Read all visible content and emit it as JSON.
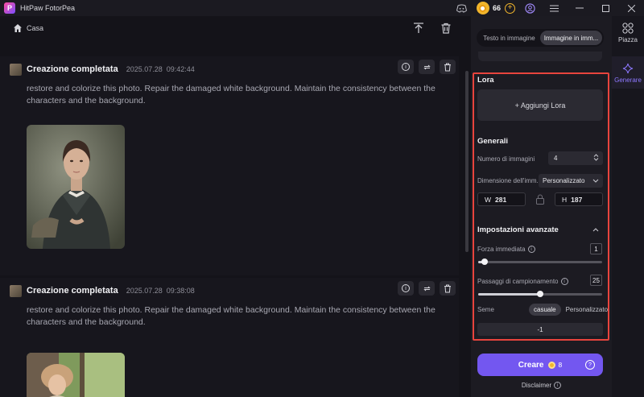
{
  "app": {
    "title": "HitPaw FotorPea",
    "logo_letter": "P"
  },
  "titlebar": {
    "coins": "66",
    "add": "+"
  },
  "nav": {
    "home_label": "Casa"
  },
  "results": [
    {
      "title": "Creazione completata",
      "date": "2025.07.28",
      "time": "09:42:44",
      "prompt": "restore and colorize this photo. Repair the damaged white background. Maintain the consistency between the characters and the background."
    },
    {
      "title": "Creazione completata",
      "date": "2025.07.28",
      "time": "09:38:08",
      "prompt": "restore and colorize this photo. Repair the damaged white background. Maintain the consistency between the characters and the background."
    }
  ],
  "panel": {
    "tabs": [
      "Testo in immagine",
      "Immagine in imm..."
    ],
    "active_tab": 1,
    "lora": {
      "title": "Lora",
      "add_label": "+ Aggiungi Lora"
    },
    "general": {
      "title": "Generali",
      "num_images_label": "Numero di immagini",
      "num_images_value": "4",
      "dimension_label": "Dimensione dell'imm...",
      "dimension_value": "Personalizzato",
      "w_label": "W",
      "w_value": "281",
      "h_label": "H",
      "h_value": "187"
    },
    "advanced": {
      "title": "Impostazioni avanzate",
      "strength_label": "Forza immediata",
      "strength_value": "1",
      "strength_fraction": 0.05,
      "steps_label": "Passaggi di campionamento",
      "steps_value": "25",
      "steps_fraction": 0.5,
      "seed_label": "Seme",
      "seed_options": [
        "casuale",
        "Personalizzato"
      ],
      "seed_selected": 0,
      "seed_value": "-1"
    },
    "create": {
      "label": "Creare",
      "cost": "8"
    },
    "disclaimer": "Disclaimer"
  },
  "rail": {
    "items": [
      {
        "label": "Piazza",
        "icon": "grid-icon"
      },
      {
        "label": "Generare",
        "icon": "sparkle-icon"
      }
    ],
    "active": 1
  },
  "colors": {
    "accent": "#7357f0",
    "highlight_border": "#e8443d",
    "coin": "#f1b52c"
  }
}
